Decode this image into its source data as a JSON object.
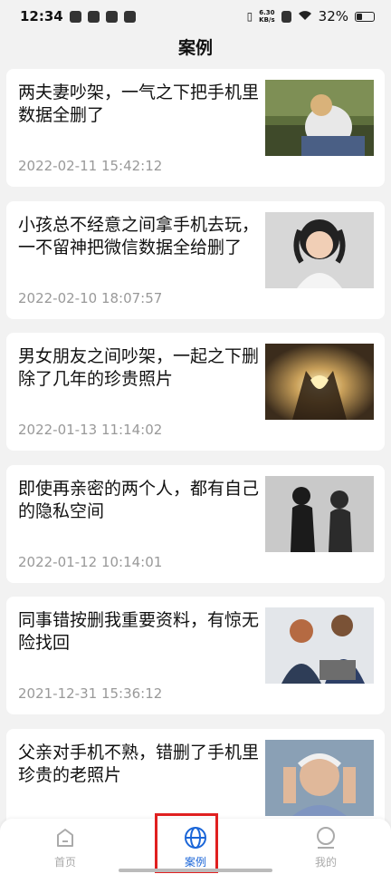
{
  "status_bar": {
    "time": "12:34",
    "net_speed_value": "6.30",
    "net_speed_unit": "KB/s",
    "battery": "32%"
  },
  "header": {
    "title": "案例"
  },
  "cases": [
    {
      "title": "两夫妻吵架，一气之下把手机里数据全删了",
      "date": "2022-02-11 15:42:12",
      "image": "distressed-woman-photo"
    },
    {
      "title": "小孩总不经意之间拿手机去玩，一不留神把微信数据全给删了",
      "date": "2022-02-10 18:07:57",
      "image": "crying-child-photo"
    },
    {
      "title": "男女朋友之间吵架，一起之下删除了几年的珍贵照片",
      "date": "2022-01-13 11:14:02",
      "image": "heart-hands-sunset-photo"
    },
    {
      "title": "即使再亲密的两个人，都有自己的隐私空间",
      "date": "2022-01-12 10:14:01",
      "image": "couple-silhouette-photo"
    },
    {
      "title": "同事错按删我重要资料，有惊无险找回",
      "date": "2021-12-31 15:36:12",
      "image": "coworkers-laptop-photo"
    },
    {
      "title": "父亲对手机不熟，错删了手机里珍贵的老照片",
      "date": "",
      "image": "worried-old-man-photo"
    }
  ],
  "tabbar": {
    "home_label": "首页",
    "cases_label": "案例",
    "mine_label": "我的",
    "active_color": "#1b66d8",
    "inactive_color": "#aaaaaa",
    "highlight_color": "#e02020"
  }
}
